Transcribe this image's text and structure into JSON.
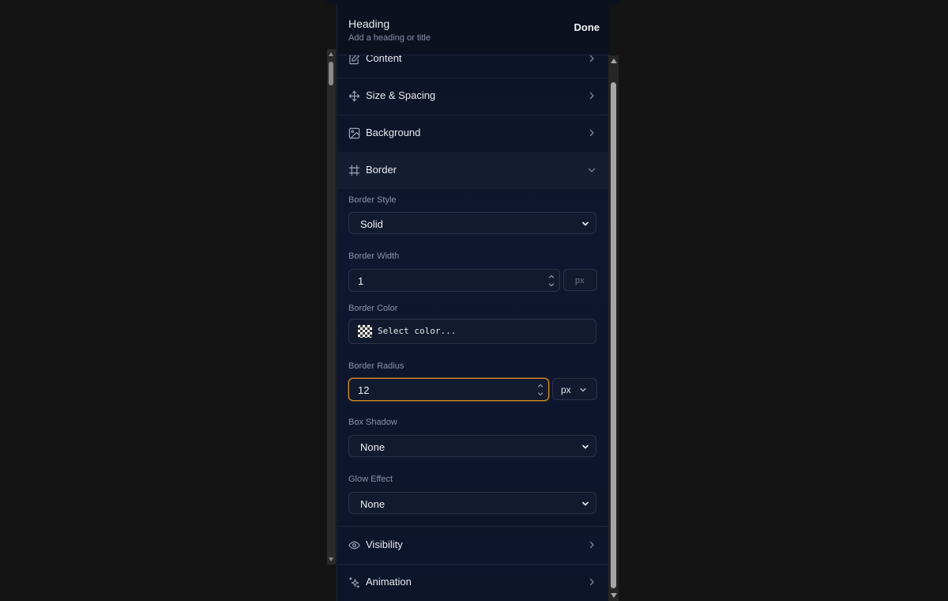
{
  "header": {
    "title": "Heading",
    "subtitle": "Add a heading or title",
    "done_label": "Done"
  },
  "sections": {
    "content": {
      "label": "Content",
      "icon": "edit-icon"
    },
    "size_spacing": {
      "label": "Size & Spacing",
      "icon": "move-icon"
    },
    "background": {
      "label": "Background",
      "icon": "image-icon"
    },
    "border": {
      "label": "Border",
      "icon": "frame-icon",
      "expanded": true
    },
    "visibility": {
      "label": "Visibility",
      "icon": "eye-icon"
    },
    "animation": {
      "label": "Animation",
      "icon": "sparkles-icon"
    }
  },
  "border": {
    "style_label": "Border Style",
    "style_value": "Solid",
    "width_label": "Border Width",
    "width_value": "1",
    "width_unit": "px",
    "color_label": "Border Color",
    "color_placeholder": "Select color...",
    "radius_label": "Border Radius",
    "radius_value": "12",
    "radius_unit": "px",
    "shadow_label": "Box Shadow",
    "shadow_value": "None",
    "glow_label": "Glow Effect",
    "glow_value": "None"
  },
  "colors": {
    "page_background": "#141414",
    "panel_background": "#0f1730",
    "focus_ring": "#d9901f"
  }
}
